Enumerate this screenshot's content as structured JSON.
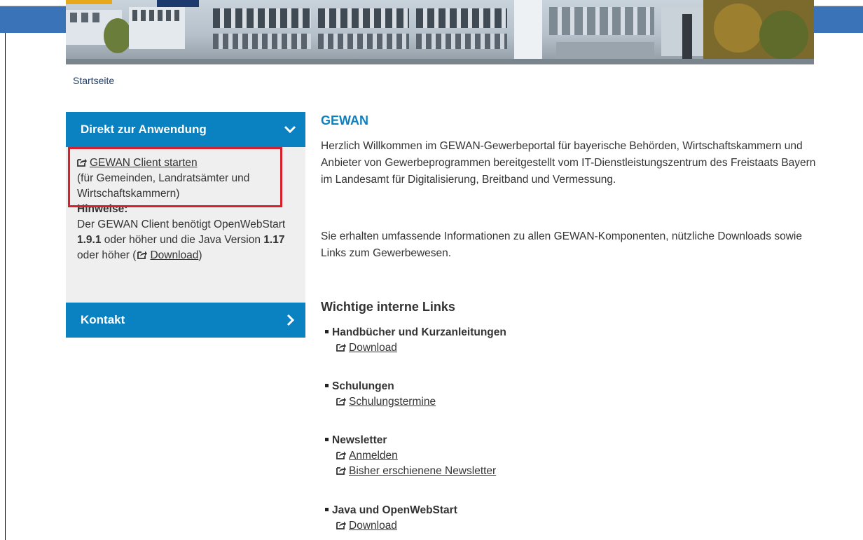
{
  "breadcrumb": {
    "home": "Startseite"
  },
  "sidebar": {
    "direkt": {
      "title": "Direkt zur Anwendung",
      "client_link": "GEWAN Client starten",
      "client_note": "(für Gemeinden, Landratsämter und Wirtschaftskammern)",
      "hinweise_label": "Hinweise:",
      "hint_part1": "Der GEWAN Client benötigt OpenWebStart ",
      "hint_ows_version": "1.9.1",
      "hint_part2": " oder höher und die Java Version ",
      "hint_java_version": "1.17",
      "hint_part3": " oder höher (",
      "hint_download": "Download",
      "hint_part4": ")"
    },
    "kontakt": {
      "title": "Kontakt"
    }
  },
  "main": {
    "title": "GEWAN",
    "intro": "Herzlich Willkommen im GEWAN-Gewerbeportal für bayerische Behörden, Wirtschaftskammern und Anbieter von Gewerbeprogrammen bereitgestellt vom IT-Dienstleistungszentrum des Freistaats Bayern im Landesamt für Digitalisierung, Breitband und Vermessung.",
    "info": "Sie erhalten umfassende Informationen zu allen GEWAN-Komponenten, nützliche Downloads sowie Links zum Gewerbewesen.",
    "links_title": "Wichtige interne Links",
    "sections": [
      {
        "title": "Handbücher und Kurzanleitungen",
        "links": [
          "Download"
        ]
      },
      {
        "title": "Schulungen",
        "links": [
          "Schulungstermine"
        ]
      },
      {
        "title": "Newsletter",
        "links": [
          "Anmelden",
          "Bisher erschienene Newsletter"
        ]
      },
      {
        "title": "Java und OpenWebStart",
        "links": [
          "Download"
        ]
      }
    ]
  },
  "colors": {
    "accent": "#0a81c1",
    "highlight_box": "#d9202a",
    "sidebar_bg": "#efefef"
  },
  "icons": {
    "external_link": "external-link-icon",
    "chevron_down": "chevron-down-icon",
    "chevron_right": "chevron-right-icon"
  }
}
